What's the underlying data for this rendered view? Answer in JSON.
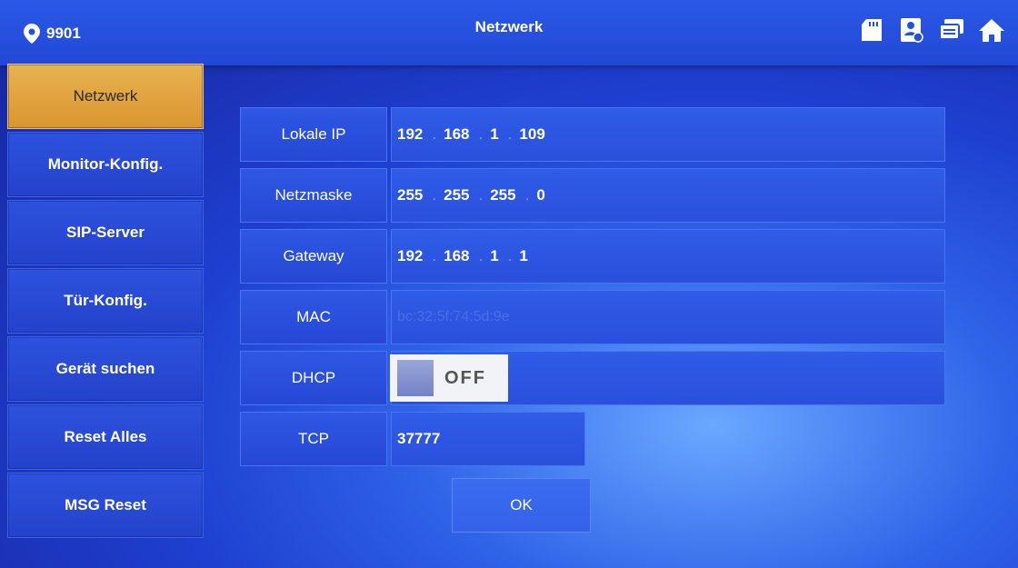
{
  "header": {
    "location": "9901",
    "title": "Netzwerk",
    "icons": [
      "sd-card-icon",
      "contacts-icon",
      "message-icon",
      "home-icon"
    ]
  },
  "sidebar": {
    "items": [
      {
        "label": "Netzwerk",
        "active": true
      },
      {
        "label": "Monitor-Konfig.",
        "active": false
      },
      {
        "label": "SIP-Server",
        "active": false
      },
      {
        "label": "Tür-Konfig.",
        "active": false
      },
      {
        "label": "Gerät suchen",
        "active": false
      },
      {
        "label": "Reset Alles",
        "active": false
      },
      {
        "label": "MSG Reset",
        "active": false
      }
    ]
  },
  "form": {
    "local_ip": {
      "label": "Lokale IP",
      "octets": [
        "192",
        "168",
        "1",
        "109"
      ]
    },
    "netmask": {
      "label": "Netzmaske",
      "octets": [
        "255",
        "255",
        "255",
        "0"
      ]
    },
    "gateway": {
      "label": "Gateway",
      "octets": [
        "192",
        "168",
        "1",
        "1"
      ]
    },
    "mac": {
      "label": "MAC",
      "value": "bc:32:5f:74:5d:9e"
    },
    "dhcp": {
      "label": "DHCP",
      "state": "OFF"
    },
    "tcp": {
      "label": "TCP",
      "value": "37777"
    },
    "ok_label": "OK",
    "ip_separator": "."
  },
  "colors": {
    "accent_active": "#e0a33e",
    "panel_blue": "#2648d4",
    "background": "#1e3fd0"
  }
}
